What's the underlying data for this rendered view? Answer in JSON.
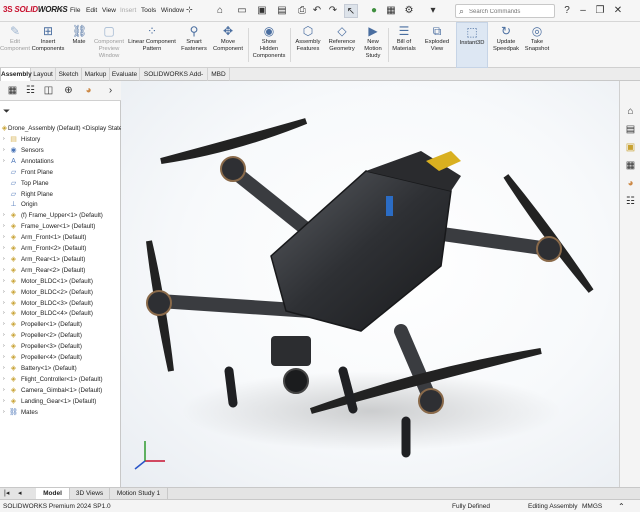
{
  "app": {
    "logo_prefix": "3S",
    "logo_solid": "SOLID",
    "logo_works": "WORKS"
  },
  "menubar": {
    "items": [
      {
        "label": "File"
      },
      {
        "label": "Edit"
      },
      {
        "label": "View"
      },
      {
        "label": "Insert"
      },
      {
        "label": "Tools"
      },
      {
        "label": "Window"
      }
    ]
  },
  "search": {
    "placeholder": "Search Commands"
  },
  "ribbon": {
    "buttons": [
      {
        "label": "Edit\nComponent",
        "icon": "edit-component-icon",
        "enabled": false
      },
      {
        "label": "Insert\nComponents",
        "icon": "insert-components-icon",
        "enabled": true
      },
      {
        "label": "Mate",
        "icon": "mate-icon",
        "enabled": true
      },
      {
        "label": "Component\nPreview\nWindow",
        "icon": "component-preview-icon",
        "enabled": false
      },
      {
        "label": "Linear Component\nPattern",
        "icon": "linear-pattern-icon",
        "enabled": true
      },
      {
        "label": "Smart\nFasteners",
        "icon": "smart-fasteners-icon",
        "enabled": true
      },
      {
        "label": "Move\nComponent",
        "icon": "move-component-icon",
        "enabled": true
      },
      {
        "label": "Show\nHidden\nComponents",
        "icon": "show-hidden-icon",
        "enabled": true
      },
      {
        "label": "Assembly\nFeatures",
        "icon": "assembly-features-icon",
        "enabled": true
      },
      {
        "label": "Reference\nGeometry",
        "icon": "reference-geometry-icon",
        "enabled": true
      },
      {
        "label": "New\nMotion\nStudy",
        "icon": "motion-study-icon",
        "enabled": true
      },
      {
        "label": "Bill of\nMaterials",
        "icon": "bill-of-materials-icon",
        "enabled": true
      },
      {
        "label": "Exploded\nView",
        "icon": "exploded-view-icon",
        "enabled": true
      },
      {
        "label": "Instant3D",
        "icon": "instant3d-icon",
        "enabled": true,
        "active": true
      },
      {
        "label": "Update\nSpeedpak",
        "icon": "update-speedpak-icon",
        "enabled": true
      },
      {
        "label": "Take\nSnapshot",
        "icon": "take-snapshot-icon",
        "enabled": true
      }
    ]
  },
  "command_tabs": [
    {
      "label": "Assembly",
      "active": true
    },
    {
      "label": "Layout"
    },
    {
      "label": "Sketch"
    },
    {
      "label": "Markup"
    },
    {
      "label": "Evaluate"
    },
    {
      "label": "SOLIDWORKS Add-Ins"
    },
    {
      "label": "MBD"
    }
  ],
  "feature_tree": {
    "root": "Drone_Assembly (Default) <Display State-1>",
    "items": [
      {
        "label": "History",
        "icon": "history-folder-icon"
      },
      {
        "label": "Sensors",
        "icon": "sensors-icon"
      },
      {
        "label": "Annotations",
        "icon": "annotations-icon"
      },
      {
        "label": "Front Plane",
        "icon": "plane-icon"
      },
      {
        "label": "Top Plane",
        "icon": "plane-icon"
      },
      {
        "label": "Right Plane",
        "icon": "plane-icon"
      },
      {
        "label": "Origin",
        "icon": "origin-icon"
      },
      {
        "label": "(f) Frame_Upper<1> (Default)",
        "icon": "part-icon"
      },
      {
        "label": "Frame_Lower<1> (Default)",
        "icon": "part-icon"
      },
      {
        "label": "Arm_Front<1> (Default)",
        "icon": "part-icon"
      },
      {
        "label": "Arm_Front<2> (Default)",
        "icon": "part-icon"
      },
      {
        "label": "Arm_Rear<1> (Default)",
        "icon": "part-icon"
      },
      {
        "label": "Arm_Rear<2> (Default)",
        "icon": "part-icon"
      },
      {
        "label": "Motor_BLDC<1> (Default)",
        "icon": "part-icon"
      },
      {
        "label": "Motor_BLDC<2> (Default)",
        "icon": "part-icon"
      },
      {
        "label": "Motor_BLDC<3> (Default)",
        "icon": "part-icon"
      },
      {
        "label": "Motor_BLDC<4> (Default)",
        "icon": "part-icon"
      },
      {
        "label": "Propeller<1> (Default)",
        "icon": "part-icon"
      },
      {
        "label": "Propeller<2> (Default)",
        "icon": "part-icon"
      },
      {
        "label": "Propeller<3> (Default)",
        "icon": "part-icon"
      },
      {
        "label": "Propeller<4> (Default)",
        "icon": "part-icon"
      },
      {
        "label": "Battery<1> (Default)",
        "icon": "part-icon"
      },
      {
        "label": "Flight_Controller<1> (Default)",
        "icon": "part-icon"
      },
      {
        "label": "Camera_Gimbal<1> (Default)",
        "icon": "part-icon"
      },
      {
        "label": "Landing_Gear<1> (Default)",
        "icon": "part-icon"
      },
      {
        "label": "Mates",
        "icon": "mates-icon"
      }
    ]
  },
  "bottom_tabs": [
    {
      "label": "Model",
      "active": true
    },
    {
      "label": "3D Views"
    },
    {
      "label": "Motion Study 1"
    }
  ],
  "status_bar": {
    "product": "SOLIDWORKS Premium 2024 SP1.0",
    "state": "Fully Defined",
    "mode": "Editing Assembly",
    "units": "MMGS"
  },
  "colors": {
    "brand_red": "#c8102e",
    "accent_blue": "#4a6ea0"
  }
}
